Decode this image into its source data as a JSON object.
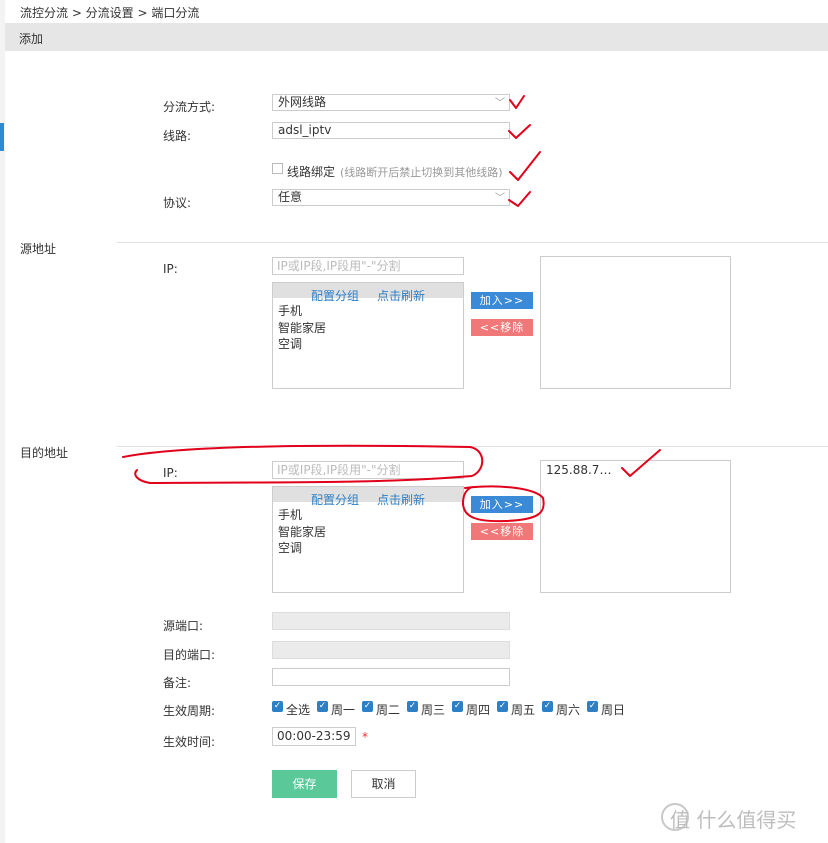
{
  "breadcrumb": "流控分流 > 分流设置 > 端口分流",
  "header": {
    "title": "添加"
  },
  "form": {
    "mode_label": "分流方式:",
    "mode_value": "外网线路",
    "line_label": "线路:",
    "line_value": "adsl_iptv",
    "bind_label": "线路绑定",
    "bind_hint": "(线路断开后禁止切换到其他线路)",
    "protocol_label": "协议:",
    "protocol_value": "任意"
  },
  "source": {
    "section_title": "源地址",
    "ip_label": "IP:",
    "ip_placeholder": "IP或IP段,IP段用\"-\"分割",
    "config_group": "配置分组",
    "refresh": "点击刷新",
    "items": [
      "手机",
      "智能家居",
      "空调"
    ],
    "add_button": "加入>>",
    "remove_button": "<<移除",
    "selected": ""
  },
  "dest": {
    "section_title": "目的地址",
    "ip_label": "IP:",
    "ip_placeholder": "IP或IP段,IP段用\"-\"分割",
    "config_group": "配置分组",
    "refresh": "点击刷新",
    "items": [
      "手机",
      "智能家居",
      "空调"
    ],
    "add_button": "加入>>",
    "remove_button": "<<移除",
    "selected": "125.88.7…"
  },
  "ports": {
    "src_label": "源端口:",
    "dst_label": "目的端口:",
    "note_label": "备注:"
  },
  "schedule": {
    "period_label": "生效周期:",
    "days": [
      "全选",
      "周一",
      "周二",
      "周三",
      "周四",
      "周五",
      "周六",
      "周日"
    ],
    "time_label": "生效时间:",
    "time_value": "00:00-23:59",
    "required_mark": "*"
  },
  "actions": {
    "save": "保存",
    "cancel": "取消"
  },
  "watermark": "值 什么值得买",
  "colors": {
    "accent": "#2d7fc6",
    "save": "#5bc89a",
    "remove": "#f07878",
    "annotation": "#e0001a"
  }
}
